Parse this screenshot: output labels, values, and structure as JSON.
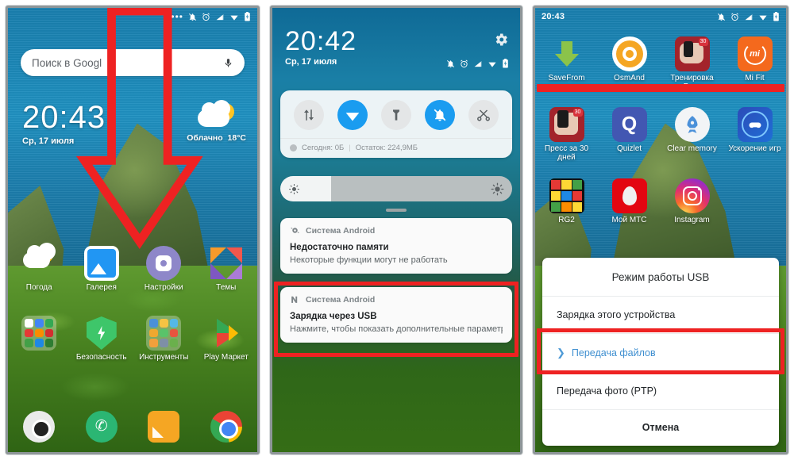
{
  "phone1": {
    "statusbar": {
      "icons": [
        "more-dots-icon",
        "bell-muted-icon",
        "alarm-icon",
        "signal-icon",
        "wifi-icon",
        "battery-charging-icon"
      ]
    },
    "search": {
      "placeholder": "Поиск в Googl",
      "mic_icon": "microphone-icon"
    },
    "clock": {
      "time": "20:43",
      "date": "Ср, 17 июля"
    },
    "weather": {
      "condition": "Облачно",
      "temperature": "18°C"
    },
    "apps_row1": [
      {
        "label": "Погода",
        "icon": "weather-app-icon"
      },
      {
        "label": "Галерея",
        "icon": "gallery-app-icon"
      },
      {
        "label": "Настройки",
        "icon": "settings-app-icon"
      },
      {
        "label": "Темы",
        "icon": "themes-app-icon"
      }
    ],
    "apps_row2": [
      {
        "label": "",
        "icon": "google-folder-icon"
      },
      {
        "label": "Безопасность",
        "icon": "security-app-icon"
      },
      {
        "label": "Инструменты",
        "icon": "tools-folder-icon"
      },
      {
        "label": "Play Маркет",
        "icon": "play-store-icon"
      }
    ],
    "dock": [
      {
        "label": "",
        "icon": "camera-icon"
      },
      {
        "label": "",
        "icon": "phone-icon"
      },
      {
        "label": "",
        "icon": "messages-icon"
      },
      {
        "label": "",
        "icon": "chrome-icon"
      }
    ],
    "annotation": {
      "shape": "down-arrow-outline",
      "color": "#ee2222"
    }
  },
  "phone2": {
    "clock": {
      "time": "20:42",
      "date": "Ср, 17 июля"
    },
    "gear_icon": "settings-gear-icon",
    "statusbar": {
      "icons": [
        "bell-muted-icon",
        "alarm-icon",
        "signal-icon",
        "wifi-icon",
        "battery-charging-icon"
      ]
    },
    "quick_tiles": [
      {
        "name": "data-transfer-tile",
        "active": false
      },
      {
        "name": "wifi-tile",
        "active": true
      },
      {
        "name": "flashlight-tile",
        "active": false
      },
      {
        "name": "silent-mode-tile",
        "active": true
      },
      {
        "name": "screenshot-tile",
        "active": false
      }
    ],
    "data_usage": {
      "today_label": "Сегодня: 0Б",
      "separator": "|",
      "remaining_label": "Остаток: 224,9МБ"
    },
    "brightness": {
      "low_icon": "brightness-low-icon",
      "high_icon": "brightness-high-icon",
      "level_percent": 22
    },
    "notifications": [
      {
        "app": "Система Android",
        "app_icon": "android-system-icon",
        "title": "Недостаточно памяти",
        "body": "Некоторые функции могут не работать",
        "highlighted": false
      },
      {
        "app": "Система Android",
        "app_icon": "android-n-icon",
        "title": "Зарядка через USB",
        "body": "Нажмите, чтобы показать дополнительные параметр..",
        "highlighted": true
      }
    ],
    "highlight_color": "#ee2222"
  },
  "phone3": {
    "statusbar": {
      "time": "20:43",
      "icons": [
        "bell-muted-icon",
        "alarm-icon",
        "signal-icon",
        "wifi-icon",
        "battery-charging-icon"
      ]
    },
    "apps_row1": [
      {
        "label": "SaveFrom",
        "icon": "savefrom-icon"
      },
      {
        "label": "OsmAnd",
        "icon": "osmand-icon"
      },
      {
        "label": "Тренировка Руки",
        "icon": "arm-workout-icon"
      },
      {
        "label": "Mi Fit",
        "icon": "mifit-icon"
      }
    ],
    "apps_row2": [
      {
        "label": "Пресс за 30 дней",
        "icon": "abs-30days-icon"
      },
      {
        "label": "Quizlet",
        "icon": "quizlet-icon"
      },
      {
        "label": "Clear memory",
        "icon": "clear-memory-icon"
      },
      {
        "label": "Ускорение игр",
        "icon": "game-booster-icon"
      }
    ],
    "apps_row3": [
      {
        "label": "RG2",
        "icon": "rg2-cube-icon"
      },
      {
        "label": "Мой МТС",
        "icon": "mts-icon"
      },
      {
        "label": "Instagram",
        "icon": "instagram-icon"
      },
      {
        "label": "",
        "icon": ""
      }
    ],
    "dialog": {
      "title": "Режим работы USB",
      "options": [
        {
          "label": "Зарядка этого устройства",
          "selected": false
        },
        {
          "label": "Передача файлов",
          "selected": true
        },
        {
          "label": "Передача фото (PTP)",
          "selected": false
        }
      ],
      "cancel": "Отмена",
      "highlight_color": "#ee2222"
    }
  }
}
